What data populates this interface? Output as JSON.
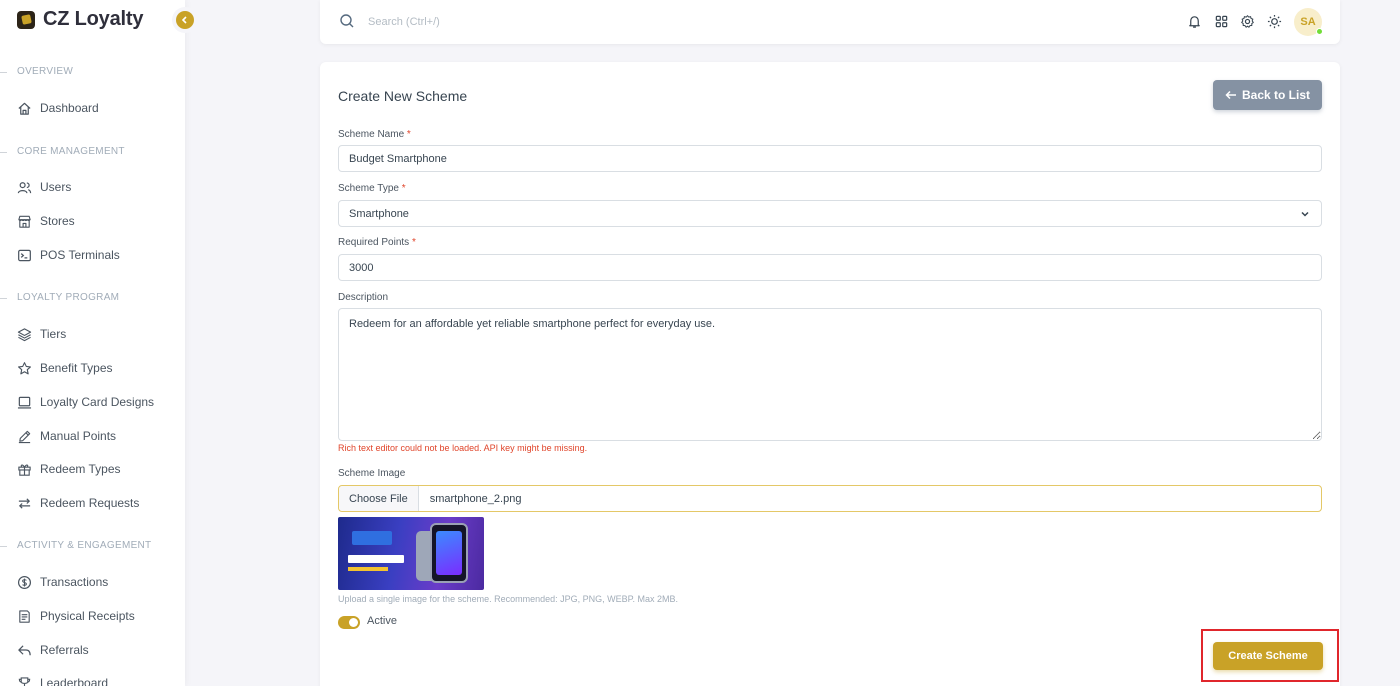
{
  "brand": {
    "name": "CZ Loyalty"
  },
  "sidebar": {
    "sections": [
      {
        "header": "OVERVIEW",
        "items": [
          {
            "label": "Dashboard",
            "icon": "home-icon"
          }
        ]
      },
      {
        "header": "CORE MANAGEMENT",
        "items": [
          {
            "label": "Users",
            "icon": "users-icon"
          },
          {
            "label": "Stores",
            "icon": "store-icon"
          },
          {
            "label": "POS Terminals",
            "icon": "terminal-icon"
          }
        ]
      },
      {
        "header": "LOYALTY PROGRAM",
        "items": [
          {
            "label": "Tiers",
            "icon": "layers-icon"
          },
          {
            "label": "Benefit Types",
            "icon": "star-icon"
          },
          {
            "label": "Loyalty Card Designs",
            "icon": "card-icon"
          },
          {
            "label": "Manual Points",
            "icon": "pencil-icon"
          },
          {
            "label": "Redeem Types",
            "icon": "gift-icon"
          },
          {
            "label": "Redeem Requests",
            "icon": "swap-icon"
          }
        ]
      },
      {
        "header": "ACTIVITY & ENGAGEMENT",
        "items": [
          {
            "label": "Transactions",
            "icon": "dollar-icon"
          },
          {
            "label": "Physical Receipts",
            "icon": "receipt-icon"
          },
          {
            "label": "Referrals",
            "icon": "reply-icon"
          },
          {
            "label": "Leaderboard",
            "icon": "trophy-icon"
          }
        ]
      }
    ]
  },
  "navbar": {
    "search_placeholder": "Search (Ctrl+/)",
    "avatar_initials": "SA"
  },
  "form": {
    "title": "Create New Scheme",
    "back_label": "Back to List",
    "scheme_name_label": "Scheme Name",
    "scheme_name_value": "Budget Smartphone",
    "scheme_type_label": "Scheme Type",
    "scheme_type_value": "Smartphone",
    "required_points_label": "Required Points",
    "required_points_value": "3000",
    "description_label": "Description",
    "description_value": "Redeem for an affordable yet reliable smartphone perfect for everyday use.",
    "editor_error": "Rich text editor could not be loaded. API key might be missing.",
    "image_label": "Scheme Image",
    "choose_file_label": "Choose File",
    "file_name": "smartphone_2.png",
    "image_help": "Upload a single image for the scheme. Recommended: JPG, PNG, WEBP. Max 2MB.",
    "active_label": "Active",
    "active": true,
    "submit_label": "Create Scheme",
    "required_mark": "*"
  },
  "colors": {
    "accent": "#c9a227",
    "secondary": "#8592a3",
    "error": "#e0452b",
    "highlight": "#e0262c"
  }
}
